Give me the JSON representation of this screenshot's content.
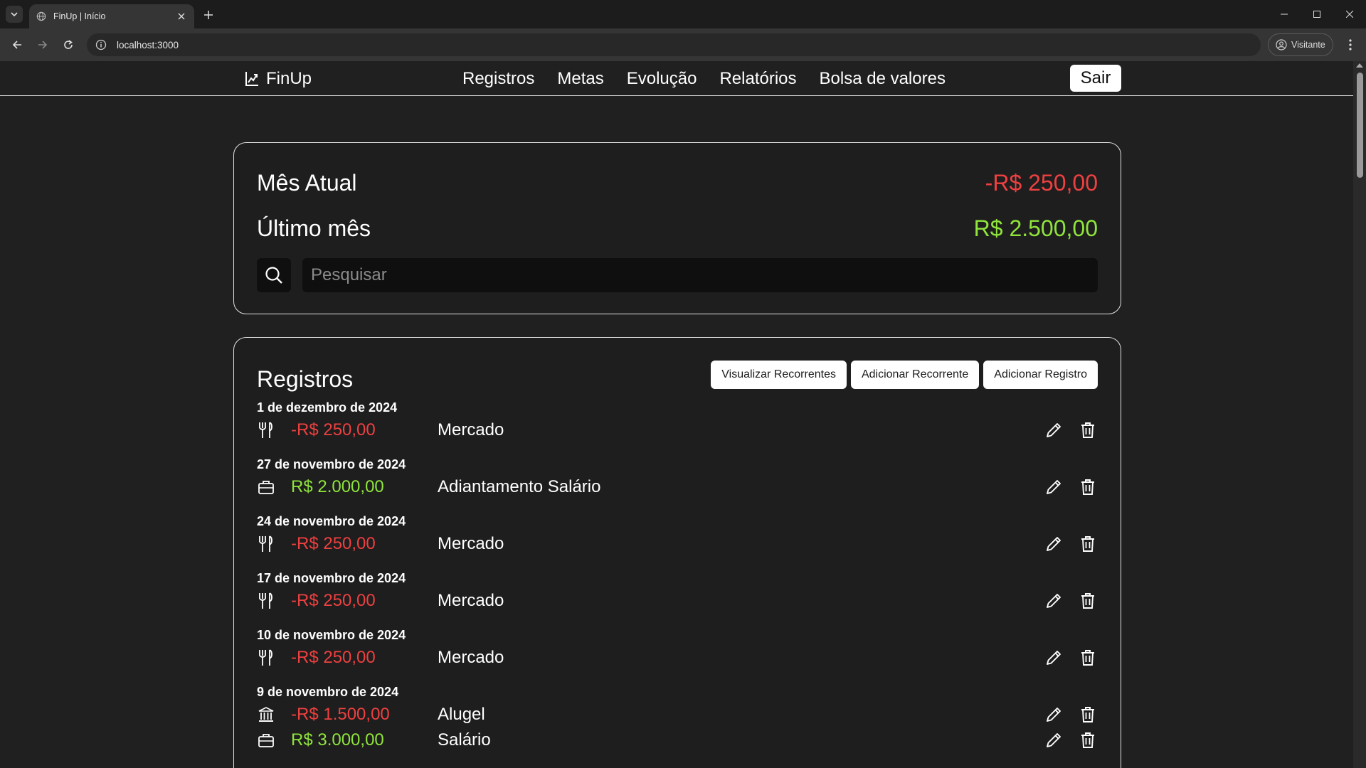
{
  "browser": {
    "tab_title": "FinUp | Início",
    "url": "localhost:3000",
    "profile_label": "Visitante"
  },
  "nav": {
    "brand": "FinUp",
    "links": [
      "Registros",
      "Metas",
      "Evolução",
      "Relatórios",
      "Bolsa de valores"
    ],
    "logout": "Sair"
  },
  "summary": {
    "current_month_label": "Mês Atual",
    "current_month_value": "-R$ 250,00",
    "last_month_label": "Último mês",
    "last_month_value": "R$ 2.500,00",
    "search_placeholder": "Pesquisar"
  },
  "records": {
    "title": "Registros",
    "buttons": [
      "Visualizar Recorrentes",
      "Adicionar Recorrente",
      "Adicionar Registro"
    ],
    "groups": [
      {
        "date": "1 de dezembro de 2024",
        "entries": [
          {
            "icon": "utensils-icon",
            "amount": "-R$ 250,00",
            "type": "expense",
            "description": "Mercado"
          }
        ]
      },
      {
        "date": "27 de novembro de 2024",
        "entries": [
          {
            "icon": "briefcase-icon",
            "amount": "R$ 2.000,00",
            "type": "income",
            "description": "Adiantamento Salário"
          }
        ]
      },
      {
        "date": "24 de novembro de 2024",
        "entries": [
          {
            "icon": "utensils-icon",
            "amount": "-R$ 250,00",
            "type": "expense",
            "description": "Mercado"
          }
        ]
      },
      {
        "date": "17 de novembro de 2024",
        "entries": [
          {
            "icon": "utensils-icon",
            "amount": "-R$ 250,00",
            "type": "expense",
            "description": "Mercado"
          }
        ]
      },
      {
        "date": "10 de novembro de 2024",
        "entries": [
          {
            "icon": "utensils-icon",
            "amount": "-R$ 250,00",
            "type": "expense",
            "description": "Mercado"
          }
        ]
      },
      {
        "date": "9 de novembro de 2024",
        "entries": [
          {
            "icon": "bank-icon",
            "amount": "-R$ 1.500,00",
            "type": "expense",
            "description": "Alugel"
          },
          {
            "icon": "briefcase-icon",
            "amount": "R$ 3.000,00",
            "type": "income",
            "description": "Salário"
          }
        ]
      }
    ]
  },
  "colors": {
    "expense": "#ee4040",
    "income": "#8fe43c",
    "background": "#202020"
  }
}
